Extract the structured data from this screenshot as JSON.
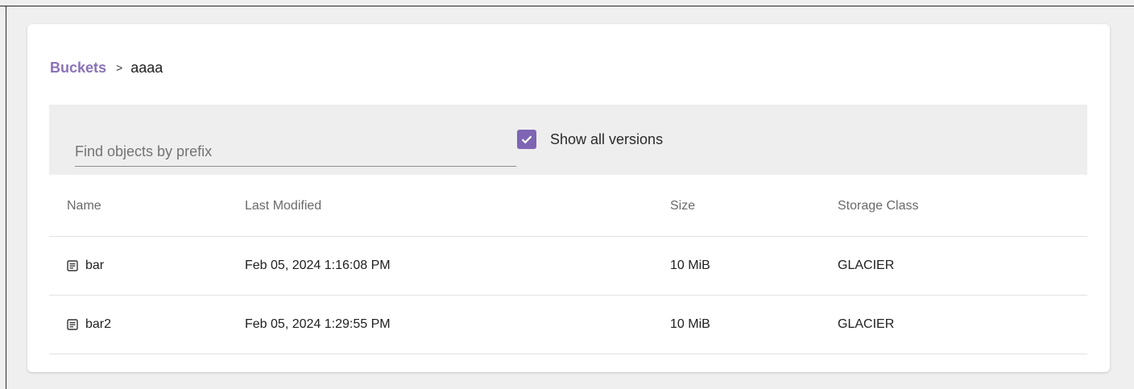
{
  "breadcrumb": {
    "root": "Buckets",
    "separator": ">",
    "current": "aaaa"
  },
  "toolbar": {
    "search_placeholder": "Find objects by prefix",
    "search_value": "",
    "show_versions_label": "Show all versions",
    "show_versions_checked": true
  },
  "table": {
    "columns": {
      "name": "Name",
      "last_modified": "Last Modified",
      "size": "Size",
      "storage_class": "Storage Class"
    },
    "rows": [
      {
        "name": "bar",
        "last_modified": "Feb 05, 2024 1:16:08 PM",
        "size": "10 MiB",
        "storage_class": "GLACIER",
        "icon": "file-icon"
      },
      {
        "name": "bar2",
        "last_modified": "Feb 05, 2024 1:29:55 PM",
        "size": "10 MiB",
        "storage_class": "GLACIER",
        "icon": "file-icon"
      }
    ]
  },
  "colors": {
    "accent": "#7e65b3",
    "link": "#8a72b8",
    "toolbar_bg": "#eeeeee",
    "page_bg": "#efefef"
  }
}
